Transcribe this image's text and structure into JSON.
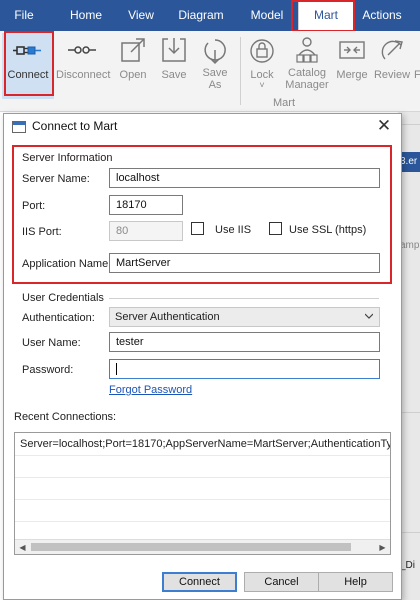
{
  "ribbon": {
    "tabs": [
      "File",
      "Home",
      "View",
      "Diagram",
      "Model",
      "Mart",
      "Actions"
    ],
    "buttons": {
      "connect": "Connect",
      "disconnect": "Disconnect",
      "open": "Open",
      "save": "Save",
      "save_as_line1": "Save",
      "save_as_line2": "As",
      "lock": "Lock",
      "catalog_manager_line1": "Catalog",
      "catalog_manager_line2": "Manager",
      "merge": "Merge",
      "review": "Review",
      "overflow": "F"
    },
    "group_label": "Mart",
    "lock_dropdown": "˅"
  },
  "background": {
    "tab_fragment": "3.er",
    "side_fragment": "amp",
    "bottom_fragment": "_Di"
  },
  "dialog": {
    "title": "Connect to Mart",
    "close_glyph": "✕",
    "server_info": {
      "title": "Server Information",
      "server_name_label": "Server Name:",
      "server_name_value": "localhost",
      "port_label": "Port:",
      "port_value": "18170",
      "iis_port_label": "IIS Port:",
      "iis_port_value": "80",
      "use_iis_label": "Use IIS",
      "use_ssl_label": "Use SSL (https)",
      "app_name_label": "Application Name:",
      "app_name_value": "MartServer"
    },
    "credentials": {
      "title": "User Credentials",
      "auth_label": "Authentication:",
      "auth_value": "Server Authentication",
      "user_label": "User Name:",
      "user_value": "tester",
      "password_label": "Password:",
      "password_value": "",
      "forgot": "Forgot Password"
    },
    "recent": {
      "title": "Recent Connections:",
      "items": [
        "Server=localhost;Port=18170;AppServerName=MartServer;AuthenticationTy..."
      ]
    },
    "buttons": {
      "connect": "Connect",
      "cancel": "Cancel",
      "help": "Help"
    }
  },
  "colors": {
    "ribbon_blue": "#2b579a",
    "highlight_red": "#d9262b",
    "focus_blue": "#3c7fd0",
    "link_blue": "#1c55b8"
  }
}
